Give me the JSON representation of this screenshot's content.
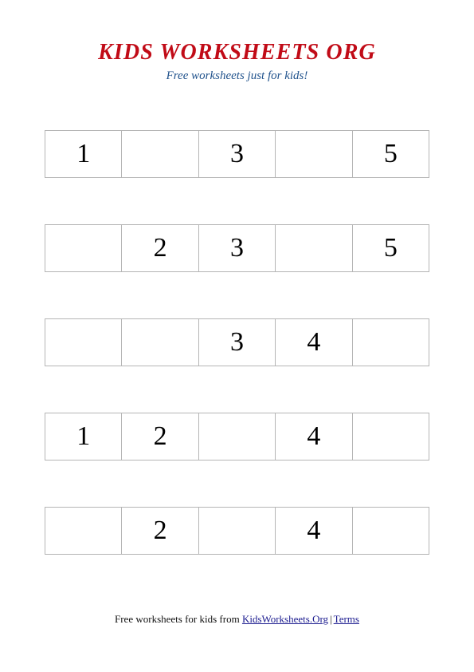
{
  "header": {
    "title": "KIDS WORKSHEETS ORG",
    "tagline": "Free worksheets just for kids!",
    "title_color": "#c10b17",
    "tagline_color": "#20528c"
  },
  "worksheet": {
    "columns": 5,
    "border_color": "#b5b5b5",
    "rows": [
      {
        "cells": [
          "1",
          "",
          "3",
          "",
          "5"
        ]
      },
      {
        "cells": [
          "",
          "2",
          "3",
          "",
          "5"
        ]
      },
      {
        "cells": [
          "",
          "",
          "3",
          "4",
          ""
        ]
      },
      {
        "cells": [
          "1",
          "2",
          "",
          "4",
          ""
        ]
      },
      {
        "cells": [
          "",
          "2",
          "",
          "4",
          ""
        ]
      }
    ]
  },
  "footer": {
    "prefix": "Free worksheets for kids from ",
    "site_link": "KidsWorksheets.Org",
    "separator": "|",
    "terms_link": "Terms",
    "link_color": "#1b1b8f"
  }
}
